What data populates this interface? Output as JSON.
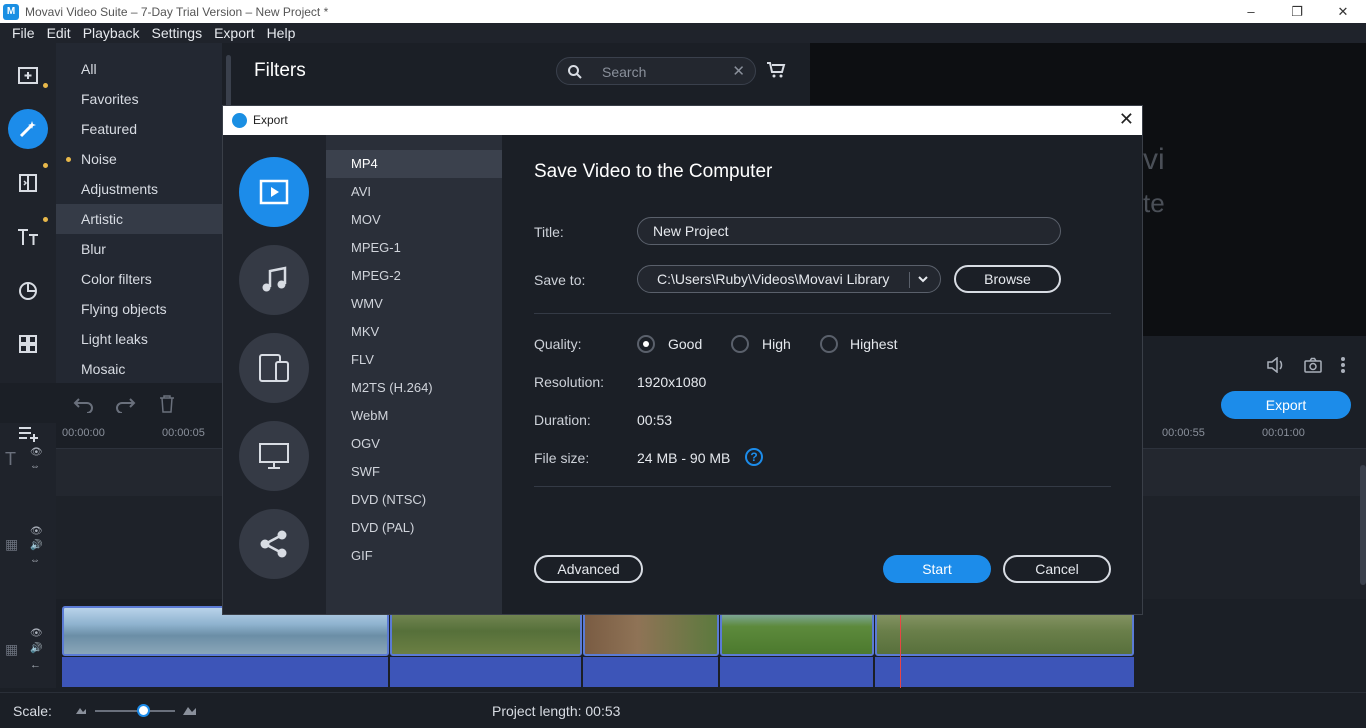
{
  "window": {
    "title": "Movavi Video Suite – 7-Day Trial Version – New Project *",
    "minimize": "–",
    "restore": "❐",
    "close": "✕"
  },
  "menu": [
    "File",
    "Edit",
    "Playback",
    "Settings",
    "Export",
    "Help"
  ],
  "filters_panel": {
    "title": "Filters",
    "search_placeholder": "Search",
    "categories": [
      "All",
      "Favorites",
      "Featured",
      "Noise",
      "Adjustments",
      "Artistic",
      "Blur",
      "Color filters",
      "Flying objects",
      "Light leaks",
      "Mosaic"
    ],
    "selected_category": "Artistic"
  },
  "preview": {
    "text_line1": "vi",
    "text_line2": "te"
  },
  "timeline": {
    "export_label": "Export",
    "ruler_ticks_left": [
      "00:00:00",
      "00:00:05"
    ],
    "ruler_ticks_right": [
      "00:00:55",
      "00:01:00"
    ]
  },
  "status": {
    "scale_label": "Scale:",
    "project_length_label": "Project length:",
    "project_length_value": "00:53"
  },
  "export_dialog": {
    "title": "Export",
    "heading": "Save Video to the Computer",
    "formats": [
      "MP4",
      "AVI",
      "MOV",
      "MPEG-1",
      "MPEG-2",
      "WMV",
      "MKV",
      "FLV",
      "M2TS (H.264)",
      "WebM",
      "OGV",
      "SWF",
      "DVD (NTSC)",
      "DVD (PAL)",
      "GIF"
    ],
    "selected_format": "MP4",
    "title_label": "Title:",
    "title_value": "New Project",
    "save_to_label": "Save to:",
    "save_to_value": "C:\\Users\\Ruby\\Videos\\Movavi Library",
    "browse_label": "Browse",
    "quality_label": "Quality:",
    "quality_options": [
      "Good",
      "High",
      "Highest"
    ],
    "quality_selected": "Good",
    "resolution_label": "Resolution:",
    "resolution_value": "1920x1080",
    "duration_label": "Duration:",
    "duration_value": "00:53",
    "filesize_label": "File size:",
    "filesize_value": "24 MB - 90 MB",
    "help_symbol": "?",
    "advanced_label": "Advanced",
    "start_label": "Start",
    "cancel_label": "Cancel"
  },
  "colors": {
    "accent": "#1c8cea",
    "background": "#1b1f26",
    "panel": "#23272f",
    "audio_track": "#3d55b8"
  }
}
